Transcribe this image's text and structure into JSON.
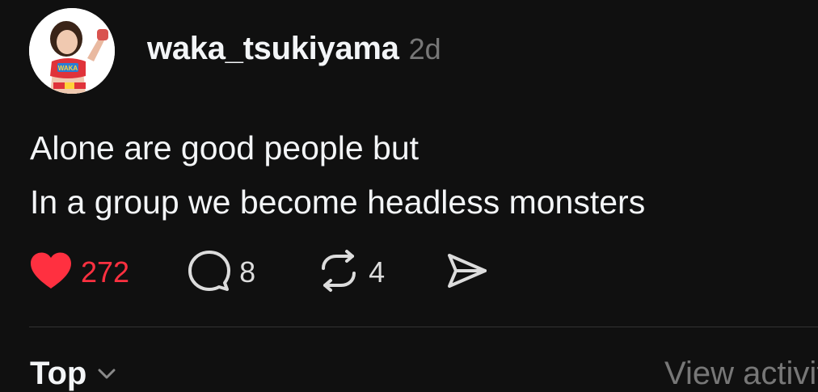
{
  "post": {
    "username": "waka_tsukiyama",
    "time": "2d",
    "lines": [
      "Alone are good people but",
      "In a group we become headless monsters"
    ]
  },
  "actions": {
    "likes": "272",
    "comments": "8",
    "reposts": "4",
    "liked": true
  },
  "footer": {
    "sort_label": "Top",
    "view_activity": "View activity"
  },
  "icons": {
    "like": "heart-filled-icon",
    "comment": "speech-bubble-icon",
    "repost": "repost-arrows-icon",
    "share": "send-icon",
    "sort": "chevron-down-icon"
  },
  "colors": {
    "background": "#101010",
    "text": "#f3f5f7",
    "muted": "#777777",
    "like": "#ff3040"
  }
}
